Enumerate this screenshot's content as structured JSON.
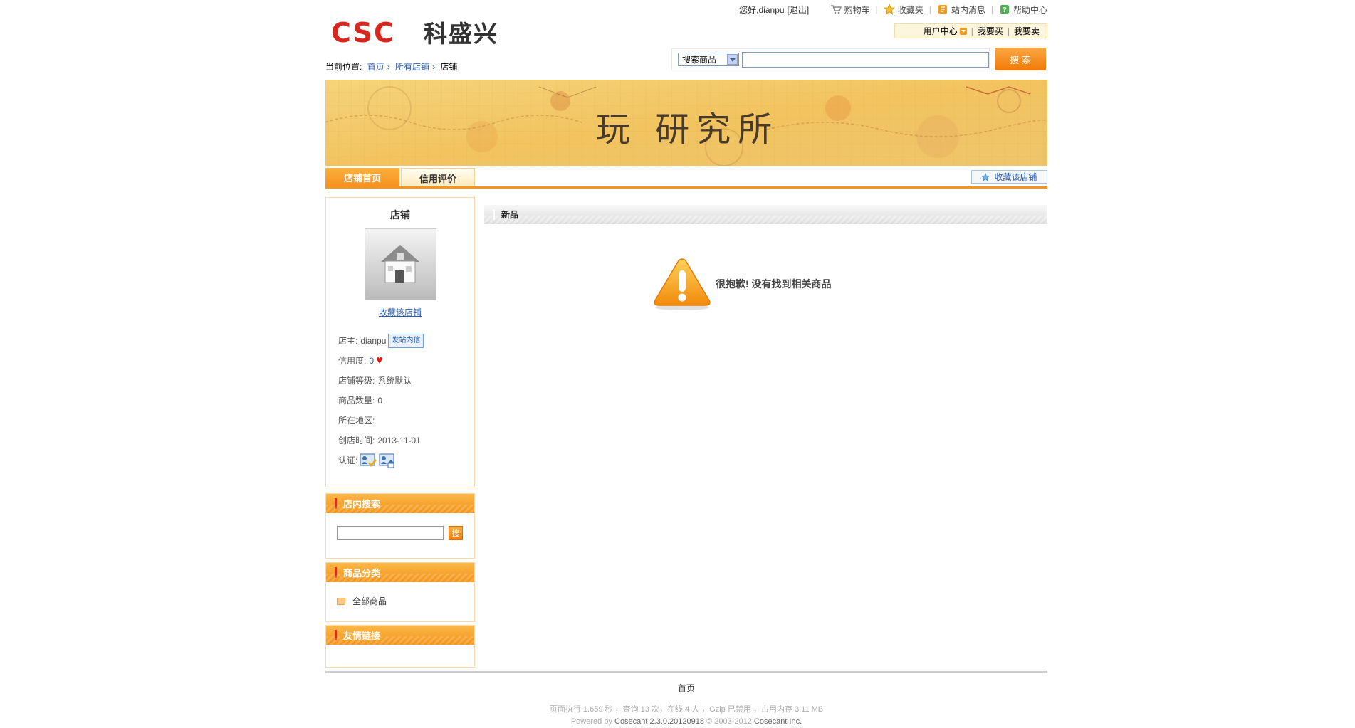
{
  "header": {
    "greeting": "您好,dianpu",
    "logout": "[退出]",
    "links": [
      {
        "label": "购物车",
        "icon": "cart-icon"
      },
      {
        "label": "收藏夹",
        "icon": "star-icon"
      },
      {
        "label": "站内消息",
        "icon": "message-icon"
      },
      {
        "label": "帮助中心",
        "icon": "help-icon"
      }
    ],
    "logo_text": "科盛兴",
    "logo_letters": "CSC",
    "user_center": "用户中心",
    "buy": "我要买",
    "sell": "我要卖"
  },
  "search": {
    "category": "搜索商品",
    "button": "搜 索"
  },
  "breadcrumb": {
    "label": "当前位置:",
    "items": [
      "首页",
      "所有店铺",
      "店铺"
    ]
  },
  "banner": {
    "title": "玩 研究所"
  },
  "tabs": {
    "items": [
      "店铺首页",
      "信用评价"
    ],
    "fav_shop": "收藏该店铺"
  },
  "shop": {
    "title": "店铺",
    "fav": "收藏该店铺",
    "owner_label": "店主:",
    "owner": "dianpu",
    "message_badge": "发站内信",
    "credit_label": "信用度:",
    "credit": "0",
    "level_label": "店铺等级:",
    "level": "系统默认",
    "goods_label": "商品数量:",
    "goods": "0",
    "region_label": "所在地区:",
    "region": "",
    "created_label": "创店时间:",
    "created": "2013-11-01",
    "cert_label": "认证:"
  },
  "sidebar": {
    "search_title": "店内搜索",
    "search_go": "搜",
    "category_title": "商品分类",
    "category_item": "全部商品",
    "links_title": "友情链接"
  },
  "main": {
    "section_title": "新品",
    "empty_message": "很抱歉! 没有找到相关商品"
  },
  "footer": {
    "nav": "首页",
    "stats": "页面执行 1.659 秒 ，查询 13 次，在线 4 人 ，Gzip 已禁用 ，占用内存 3.11 MB",
    "powered_prefix": "Powered by",
    "powered_product": "Cosecant 2.3.0.20120918",
    "powered_copy": "© 2003-2012",
    "powered_company": "Cosecant Inc."
  },
  "colors": {
    "accent": "#f7941d",
    "logo_red": "#d7261d",
    "link": "#2a5db0"
  }
}
